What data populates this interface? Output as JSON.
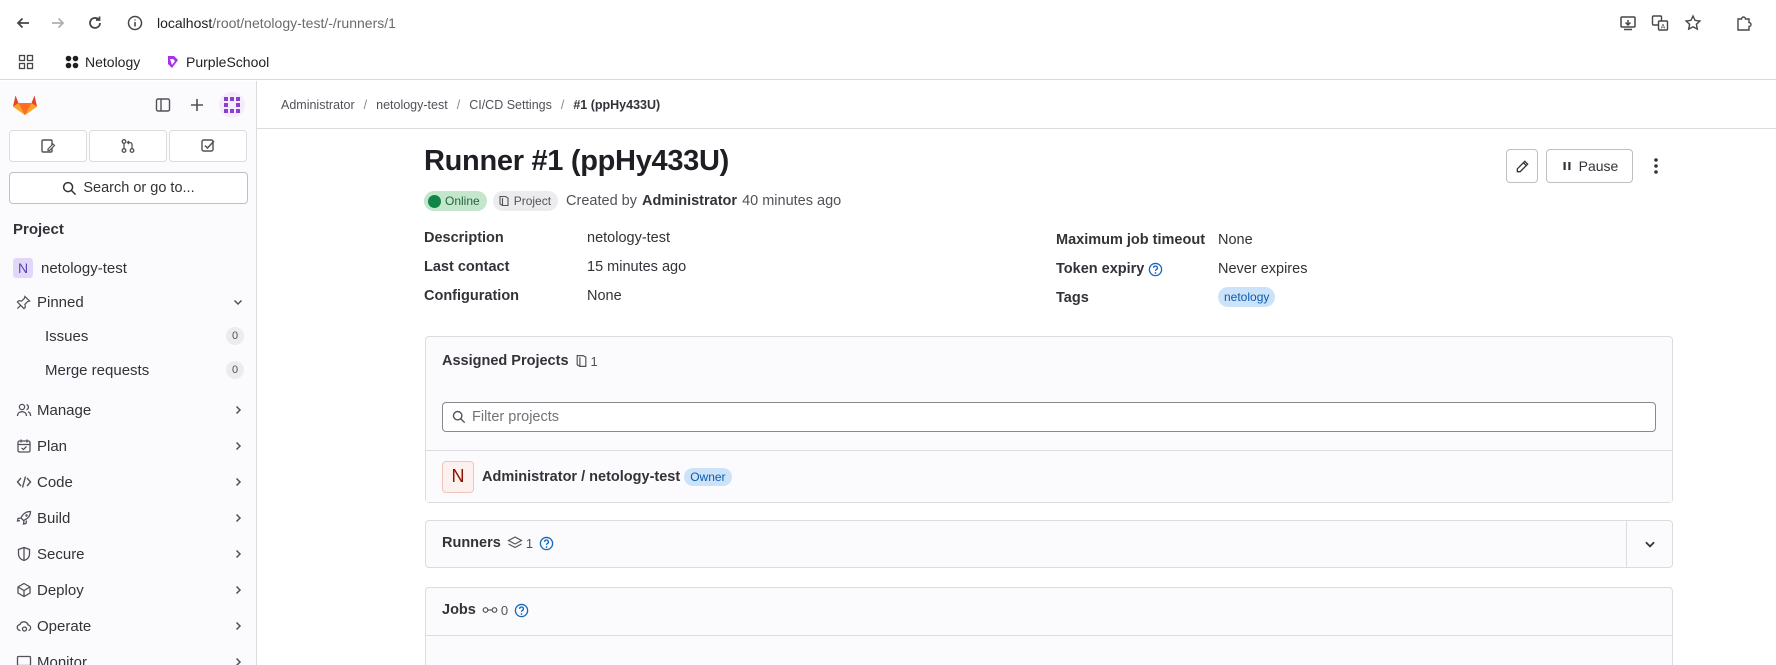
{
  "browser": {
    "url_host": "localhost",
    "url_path": "/root/netology-test/-/runners/1",
    "bookmarks": [
      {
        "label": "Netology",
        "icon": "netology-icon"
      },
      {
        "label": "PurpleSchool",
        "icon": "purpleschool-icon"
      }
    ]
  },
  "sidebar": {
    "search_label": "Search or go to...",
    "section_heading": "Project",
    "project_initial": "N",
    "project_name": "netology-test",
    "pinned_label": "Pinned",
    "pinned_items": [
      {
        "label": "Issues",
        "count": "0"
      },
      {
        "label": "Merge requests",
        "count": "0"
      }
    ],
    "nav_items": [
      {
        "label": "Manage",
        "icon": "users-icon"
      },
      {
        "label": "Plan",
        "icon": "calendar-icon"
      },
      {
        "label": "Code",
        "icon": "code-icon"
      },
      {
        "label": "Build",
        "icon": "rocket-icon"
      },
      {
        "label": "Secure",
        "icon": "shield-icon"
      },
      {
        "label": "Deploy",
        "icon": "deploy-icon"
      },
      {
        "label": "Operate",
        "icon": "cloud-gear-icon"
      },
      {
        "label": "Monitor",
        "icon": "monitor-icon"
      }
    ]
  },
  "breadcrumb": [
    "Administrator",
    "netology-test",
    "CI/CD Settings",
    "#1 (ppHy433U)"
  ],
  "runner": {
    "title": "Runner #1 (ppHy433U)",
    "status_badge": "Online",
    "type_badge": "Project",
    "created_prefix": "Created by",
    "created_by": "Administrator",
    "created_when": "40 minutes ago",
    "pause_label": "Pause"
  },
  "details_left": [
    {
      "label": "Description",
      "value": "netology-test"
    },
    {
      "label": "Last contact",
      "value": "15 minutes ago"
    },
    {
      "label": "Configuration",
      "value": "None"
    }
  ],
  "details_right": {
    "timeout_label": "Maximum job timeout",
    "timeout_value": "None",
    "token_label": "Token expiry",
    "token_value": "Never expires",
    "tags_label": "Tags",
    "tag": "netology"
  },
  "assigned_projects": {
    "title": "Assigned Projects",
    "count": "1",
    "filter_placeholder": "Filter projects",
    "project_initial": "N",
    "project_name": "Administrator / netology-test",
    "role_badge": "Owner"
  },
  "runners_card": {
    "title": "Runners",
    "count": "1"
  },
  "jobs_card": {
    "title": "Jobs",
    "count": "0"
  },
  "colors": {
    "online_green": "#108548",
    "link_blue": "#1068bf",
    "sidebar_bg": "#fbfafd"
  }
}
